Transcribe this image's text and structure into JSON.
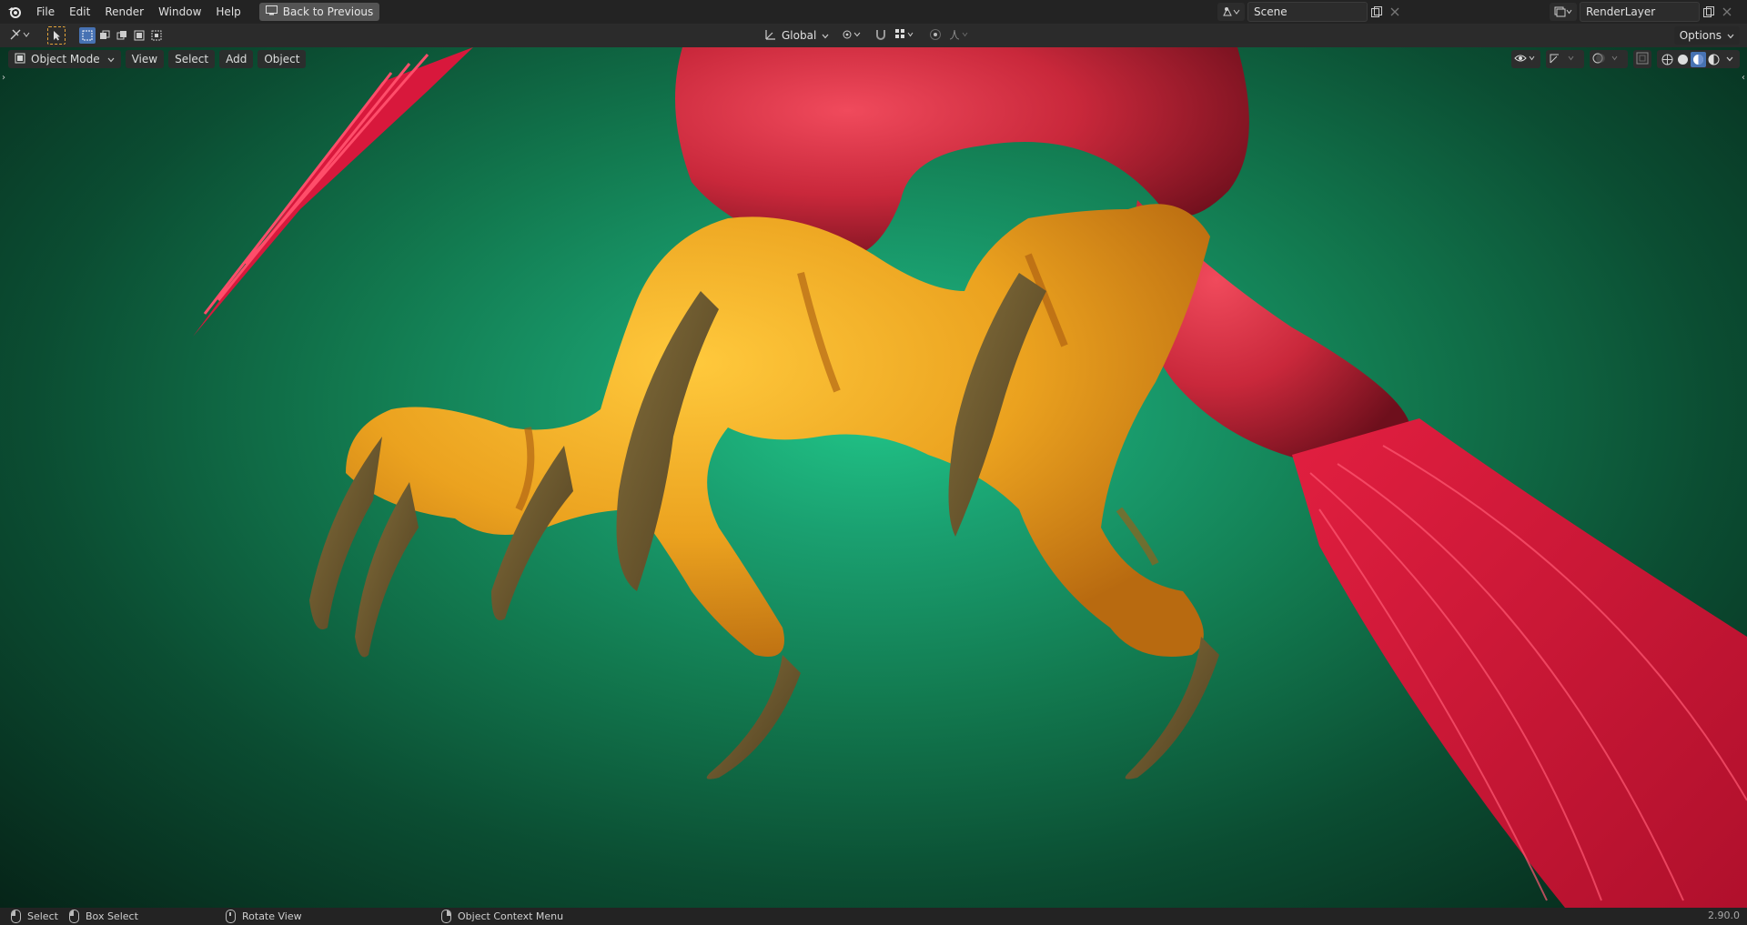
{
  "topbar": {
    "menu": [
      "File",
      "Edit",
      "Render",
      "Window",
      "Help"
    ],
    "back_label": "Back to Previous",
    "scene_name": "Scene",
    "view_layer_name": "RenderLayer"
  },
  "toolbar": {
    "orientation": "Global",
    "options_label": "Options"
  },
  "viewport": {
    "mode": "Object Mode",
    "menus": [
      "View",
      "Select",
      "Add",
      "Object"
    ],
    "active_shading": "material-preview"
  },
  "statusbar": {
    "select": "Select",
    "box_select": "Box Select",
    "rotate_view": "Rotate View",
    "context_menu": "Object Context Menu",
    "version": "2.90.0"
  },
  "colors": {
    "accent": "#4772b3",
    "viewport_center": "#21c588",
    "viewport_edge": "#062418",
    "body_red": "#c8283a",
    "claw_orange": "#e8a020",
    "talon_brown": "#6e5a2e"
  }
}
